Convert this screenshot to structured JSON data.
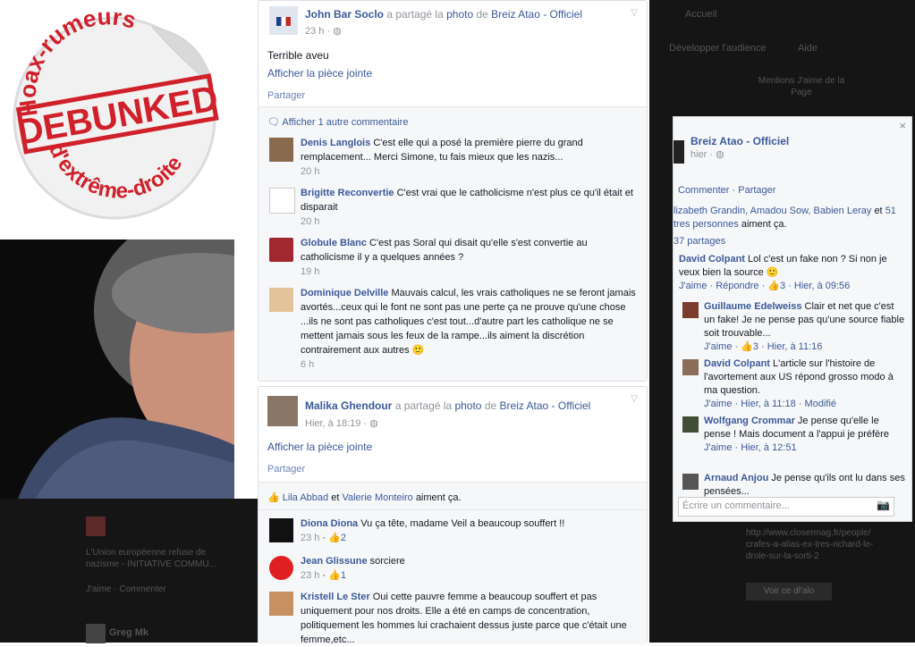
{
  "stamp": {
    "top_text": "Hoax-rumeurs",
    "middle_text": "DEBUNKED",
    "bottom_text": "d'extrême-droite"
  },
  "post1": {
    "author": "John Bar Soclo",
    "shared_text": "a partagé la",
    "photo_word": "photo",
    "de_word": "de",
    "page": "Breiz Atao - Officiel",
    "time": "23 h",
    "body": "Terrible aveu",
    "attachment": "Afficher la pièce jointe",
    "share": "Partager",
    "more_comments": "Afficher 1 autre commentaire",
    "comments": [
      {
        "name": "Denis Langlois",
        "text": "C'est elle qui a posé la première pierre du grand remplacement... Merci Simone, tu fais mieux que les nazis...",
        "time": "20 h"
      },
      {
        "name": "Brigitte Reconvertie",
        "text": "C'est vrai que le catholicisme n'est plus ce qu'il était et disparait",
        "time": "20 h"
      },
      {
        "name": "Globule Blanc",
        "text": "C'est pas Soral qui disait qu'elle s'est convertie au catholicisme il y a quelques années ?",
        "time": "19 h"
      },
      {
        "name": "Dominique Delville",
        "text": "Mauvais calcul, les vrais catholiques ne se feront jamais avortés...ceux qui le font ne sont pas une perte ça ne prouve qu'une chose ...ils ne sont pas catholiques c'est tout...d'autre part les catholique ne se mettent jamais sous les feux de la rampe...ils aiment la discrétion contrairement aux autres 🙂",
        "time": "6 h"
      }
    ]
  },
  "post2": {
    "author": "Malika Ghendour",
    "shared_text": "a partagé la",
    "photo_word": "photo",
    "de_word": "de",
    "page": "Breiz Atao - Officiel",
    "time": "Hier, à 18:19",
    "attachment": "Afficher la pièce jointe",
    "share": "Partager",
    "likers_a": "Lila Abbad",
    "likers_and": "et",
    "likers_b": "Valerie Monteiro",
    "likes_suffix": "aiment ça.",
    "comments": [
      {
        "name": "Diona Diona",
        "text": "Vu ça tête, madame Veil a beaucoup souffert !!",
        "time": "23 h",
        "likes": "2"
      },
      {
        "name": "Jean Glissune",
        "text": "sorciere",
        "time": "23 h",
        "likes": "1"
      },
      {
        "name": "Kristell Le Ster",
        "text": "Oui cette pauvre femme a beaucoup souffert et pas uniquement pour nos droits. Elle a été en camps de concentration, politiquement les hommes lui crachaient dessus juste parce que c'était une femme,etc..."
      }
    ]
  },
  "right": {
    "page": "Breiz Atao - Officiel",
    "time": "hier",
    "comment": "Commenter",
    "share": "Partager",
    "likes_names": "lizabeth Grandin, Amadou Sow, Babien Leray",
    "likes_and": "et",
    "likes_count": "51",
    "likes_more": "tres personnes",
    "likes_suffix": "aiment ça.",
    "shares": "37 partages",
    "comments": [
      {
        "name": "David Colpant",
        "text": "Lol c'est un fake non ? Si non je veux bien la source 🙂",
        "meta": "J'aime · Répondre · 👍3 · Hier, à 09:56"
      },
      {
        "name": "Guillaume Edelweiss",
        "text": "Clair et net que c'est un fake! Je ne pense pas qu'une source fiable soit trouvable...",
        "meta": "J'aime · 👍3 · Hier, à 11:16"
      },
      {
        "name": "David Colpant",
        "text": "L'article sur l'histoire de l'avortement aux US répond grosso modo à ma question.",
        "meta": "J'aime · Hier, à 11:18 · Modifié"
      },
      {
        "name": "Wolfgang Crommar",
        "text": "Je pense qu'elle le pense ! Mais document a l'appui je préfère",
        "meta": "J'aime · Hier, à 12:51"
      },
      {
        "name": "Arnaud Anjou",
        "text": "Je pense qu'ils ont lu dans ses pensées..."
      }
    ],
    "comment_placeholder": "Écrire un commentaire..."
  },
  "background": {
    "accueil": "Accueil",
    "audience": "Développer l'audience",
    "aide": "Aide",
    "voir_page": "Mentions J'aime de la Page",
    "lower_text": "L'Union européenne refuse de nazisme - INITIATIVE COMMU...",
    "lower_actions": "J'aime · Commenter",
    "lower_name": "Greg Mk",
    "link_text": "http://www.closermag.fr/people/ crafes-a-alias-ex-tres-richard-le-drole-sur-la-sorti-2",
    "button": "Voir ce dl'alo"
  },
  "colors": {
    "link": "#3b5998",
    "grey": "#90949c",
    "stamp_red": "#d0202a",
    "dark_bg": "#151515"
  }
}
